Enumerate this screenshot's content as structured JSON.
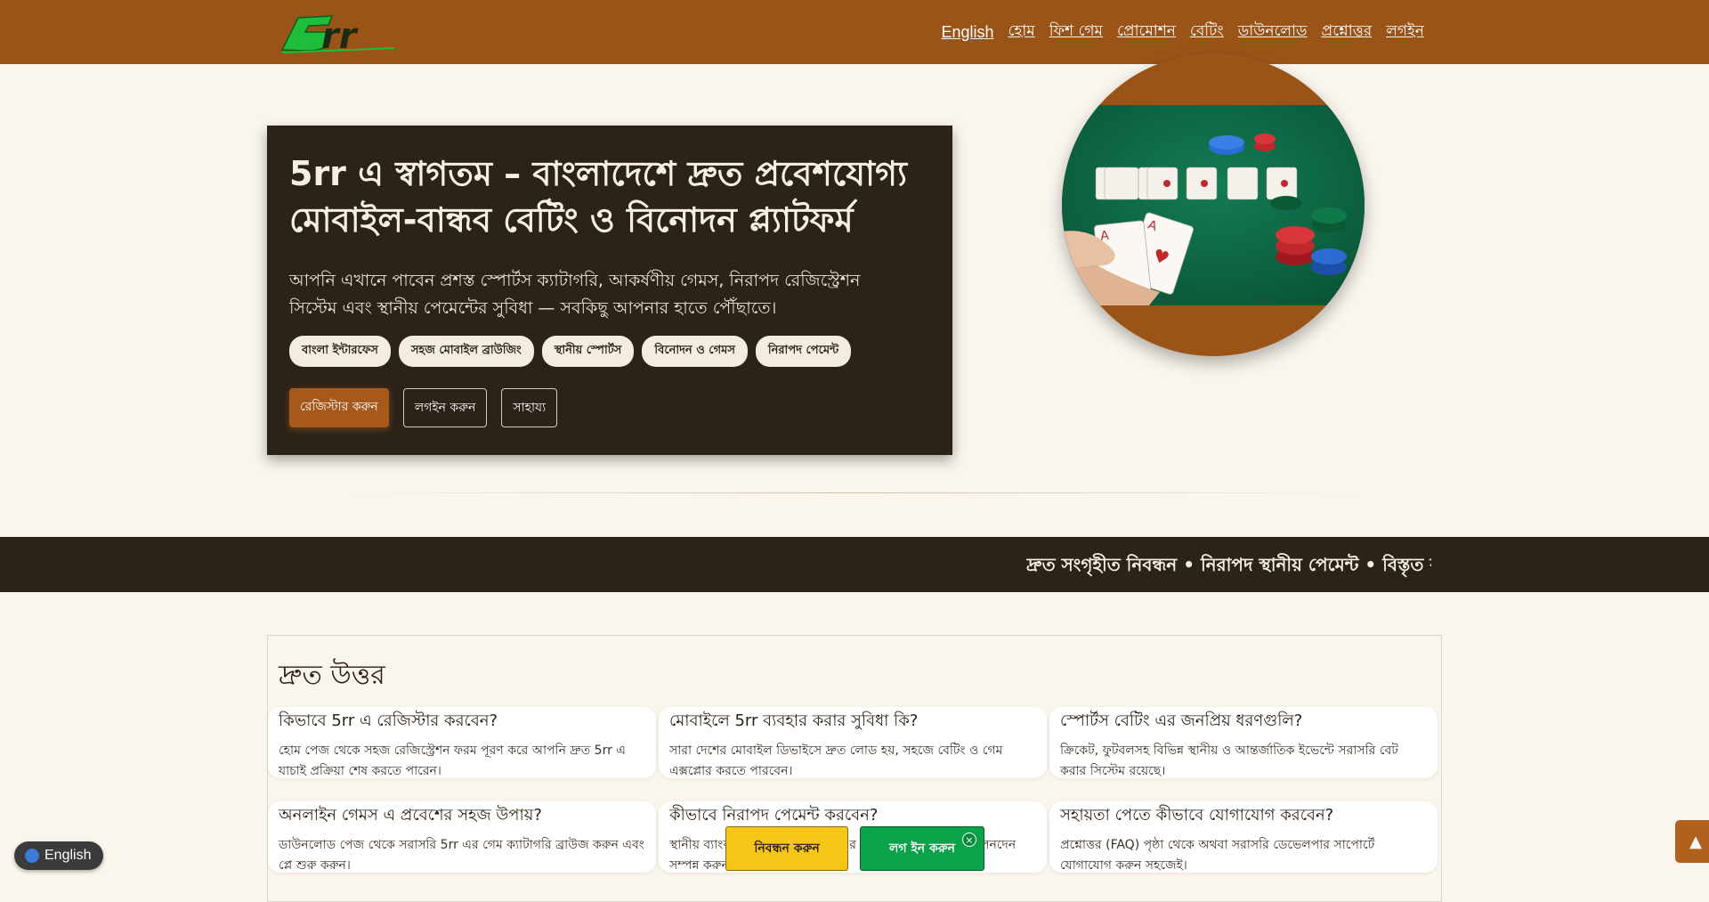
{
  "brand": {
    "logo_text": "5rr"
  },
  "nav": {
    "items": [
      "English",
      "হোম",
      "ফিশ গেম",
      "প্রোমোশন",
      "বেটিং",
      "ডাউনলোড",
      "প্রশ্নোত্তর",
      "লগইন"
    ]
  },
  "hero": {
    "title": "5rr এ স্বাগতম – বাংলাদেশে দ্রুত প্রবেশযোগ্য মোবাইল-বান্ধব বেটিং ও বিনোদন প্ল্যাটফর্ম",
    "description": "আপনি এখানে পাবেন প্রশস্ত স্পোর্টস ক্যাটাগরি, আকর্ষণীয় গেমস, নিরাপদ রেজিস্ট্রেশন সিস্টেম এবং স্থানীয় পেমেন্টের সুবিধা — সবকিছু আপনার হাতে পৌঁছাতে।",
    "tags": [
      "বাংলা ইন্টারফেস",
      "সহজ মোবাইল ব্রাউজিং",
      "স্থানীয় স্পোর্টস",
      "বিনোদন ও গেমস",
      "নিরাপদ পেমেন্ট"
    ],
    "buttons": {
      "register": "রেজিস্টার করুন",
      "login": "লগইন করুন",
      "help": "সাহায্য"
    }
  },
  "ticker": {
    "text": "দ্রুত সংগৃহীত নিবন্ধন • নিরাপদ স্থানীয় পেমেন্ট • বিস্তৃত ক্য"
  },
  "faq": {
    "title": "দ্রুত উত্তর",
    "items": [
      {
        "q": "কিভাবে 5rr এ রেজিস্টার করবেন?",
        "a": "হোম পেজ থেকে সহজ রেজিস্ট্রেশন ফরম পূরণ করে আপনি দ্রুত 5rr এ যাচাই প্রক্রিয়া শেষ করতে পারেন।"
      },
      {
        "q": "মোবাইলে 5rr ব্যবহার করার সুবিধা কি?",
        "a": "সারা দেশের মোবাইল ডিভাইসে দ্রুত লোড হয়, সহজে বেটিং ও গেম এক্সপ্লোর করতে পারবেন।"
      },
      {
        "q": "স্পোর্টস বেটিং এর জনপ্রিয় ধরণগুলি?",
        "a": "ক্রিকেট, ফুটবলসহ বিভিন্ন স্থানীয় ও আন্তর্জাতিক ইভেন্টে সরাসরি বেট করার সিস্টেম রয়েছে।"
      },
      {
        "q": "অনলাইন গেমস এ প্রবেশের সহজ উপায়?",
        "a": "ডাউনলোড পেজ থেকে সরাসরি 5rr এর গেম ক্যাটাগরি ব্রাউজ করুন এবং প্লে শুরু করুন।"
      },
      {
        "q": "কীভাবে নিরাপদ পেমেন্ট করবেন?",
        "a": "স্থানীয় ব্যাংক ও মোবাইল ওয়ালেট এর মাধ্যমে দ্রুত ও নিরাপদ লেনদেন সম্পন্ন করুন।"
      },
      {
        "q": "সহায়তা পেতে কীভাবে যোগাযোগ করবেন?",
        "a": "প্রশ্নোত্তর (FAQ) পৃষ্ঠা থেকে অথবা সরাসরি ডেভেলপার সাপোর্টে যোগাযোগ করুন সহজেই।"
      }
    ]
  },
  "language_switcher": {
    "label": "English"
  },
  "cta": {
    "register": "নিবন্ধন করুন",
    "login": "লগ ইন করুন",
    "close": "×"
  },
  "back_to_top": {
    "label": "▲"
  },
  "colors": {
    "header": "#9b5418",
    "dark": "#2b2218",
    "accent": "#a6591b",
    "register_cta": "#f5c518",
    "login_cta": "#0aa34a"
  }
}
